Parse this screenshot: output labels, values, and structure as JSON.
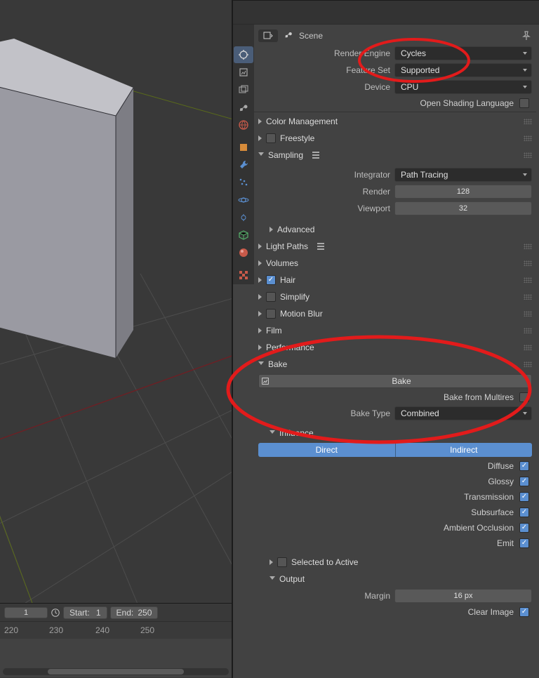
{
  "breadcrumb": {
    "scene": "Scene"
  },
  "render": {
    "engine_label": "Render Engine",
    "engine": "Cycles",
    "feature_label": "Feature Set",
    "feature": "Supported",
    "device_label": "Device",
    "device": "CPU",
    "osl_label": "Open Shading Language"
  },
  "sections": {
    "color_mgmt": "Color Management",
    "freestyle": "Freestyle",
    "sampling": "Sampling",
    "advanced": "Advanced",
    "light_paths": "Light Paths",
    "volumes": "Volumes",
    "hair": "Hair",
    "simplify": "Simplify",
    "motion_blur": "Motion Blur",
    "film": "Film",
    "performance": "Performance",
    "bake": "Bake",
    "influence": "Influence",
    "selected_active": "Selected to Active",
    "output": "Output"
  },
  "sampling": {
    "integrator_label": "Integrator",
    "integrator": "Path Tracing",
    "render_label": "Render",
    "render": "128",
    "viewport_label": "Viewport",
    "viewport": "32"
  },
  "bake": {
    "button": "Bake",
    "from_multires_label": "Bake from Multires",
    "type_label": "Bake Type",
    "type": "Combined"
  },
  "influence": {
    "direct": "Direct",
    "indirect": "Indirect",
    "diffuse": "Diffuse",
    "glossy": "Glossy",
    "transmission": "Transmission",
    "subsurface": "Subsurface",
    "ao": "Ambient Occlusion",
    "emit": "Emit"
  },
  "output": {
    "margin_label": "Margin",
    "margin": "16 px",
    "clear_label": "Clear Image"
  },
  "timeline": {
    "current": "1",
    "start_label": "Start:",
    "start": "1",
    "end_label": "End:",
    "end": "250",
    "ticks": [
      "220",
      "230",
      "240",
      "250"
    ]
  }
}
